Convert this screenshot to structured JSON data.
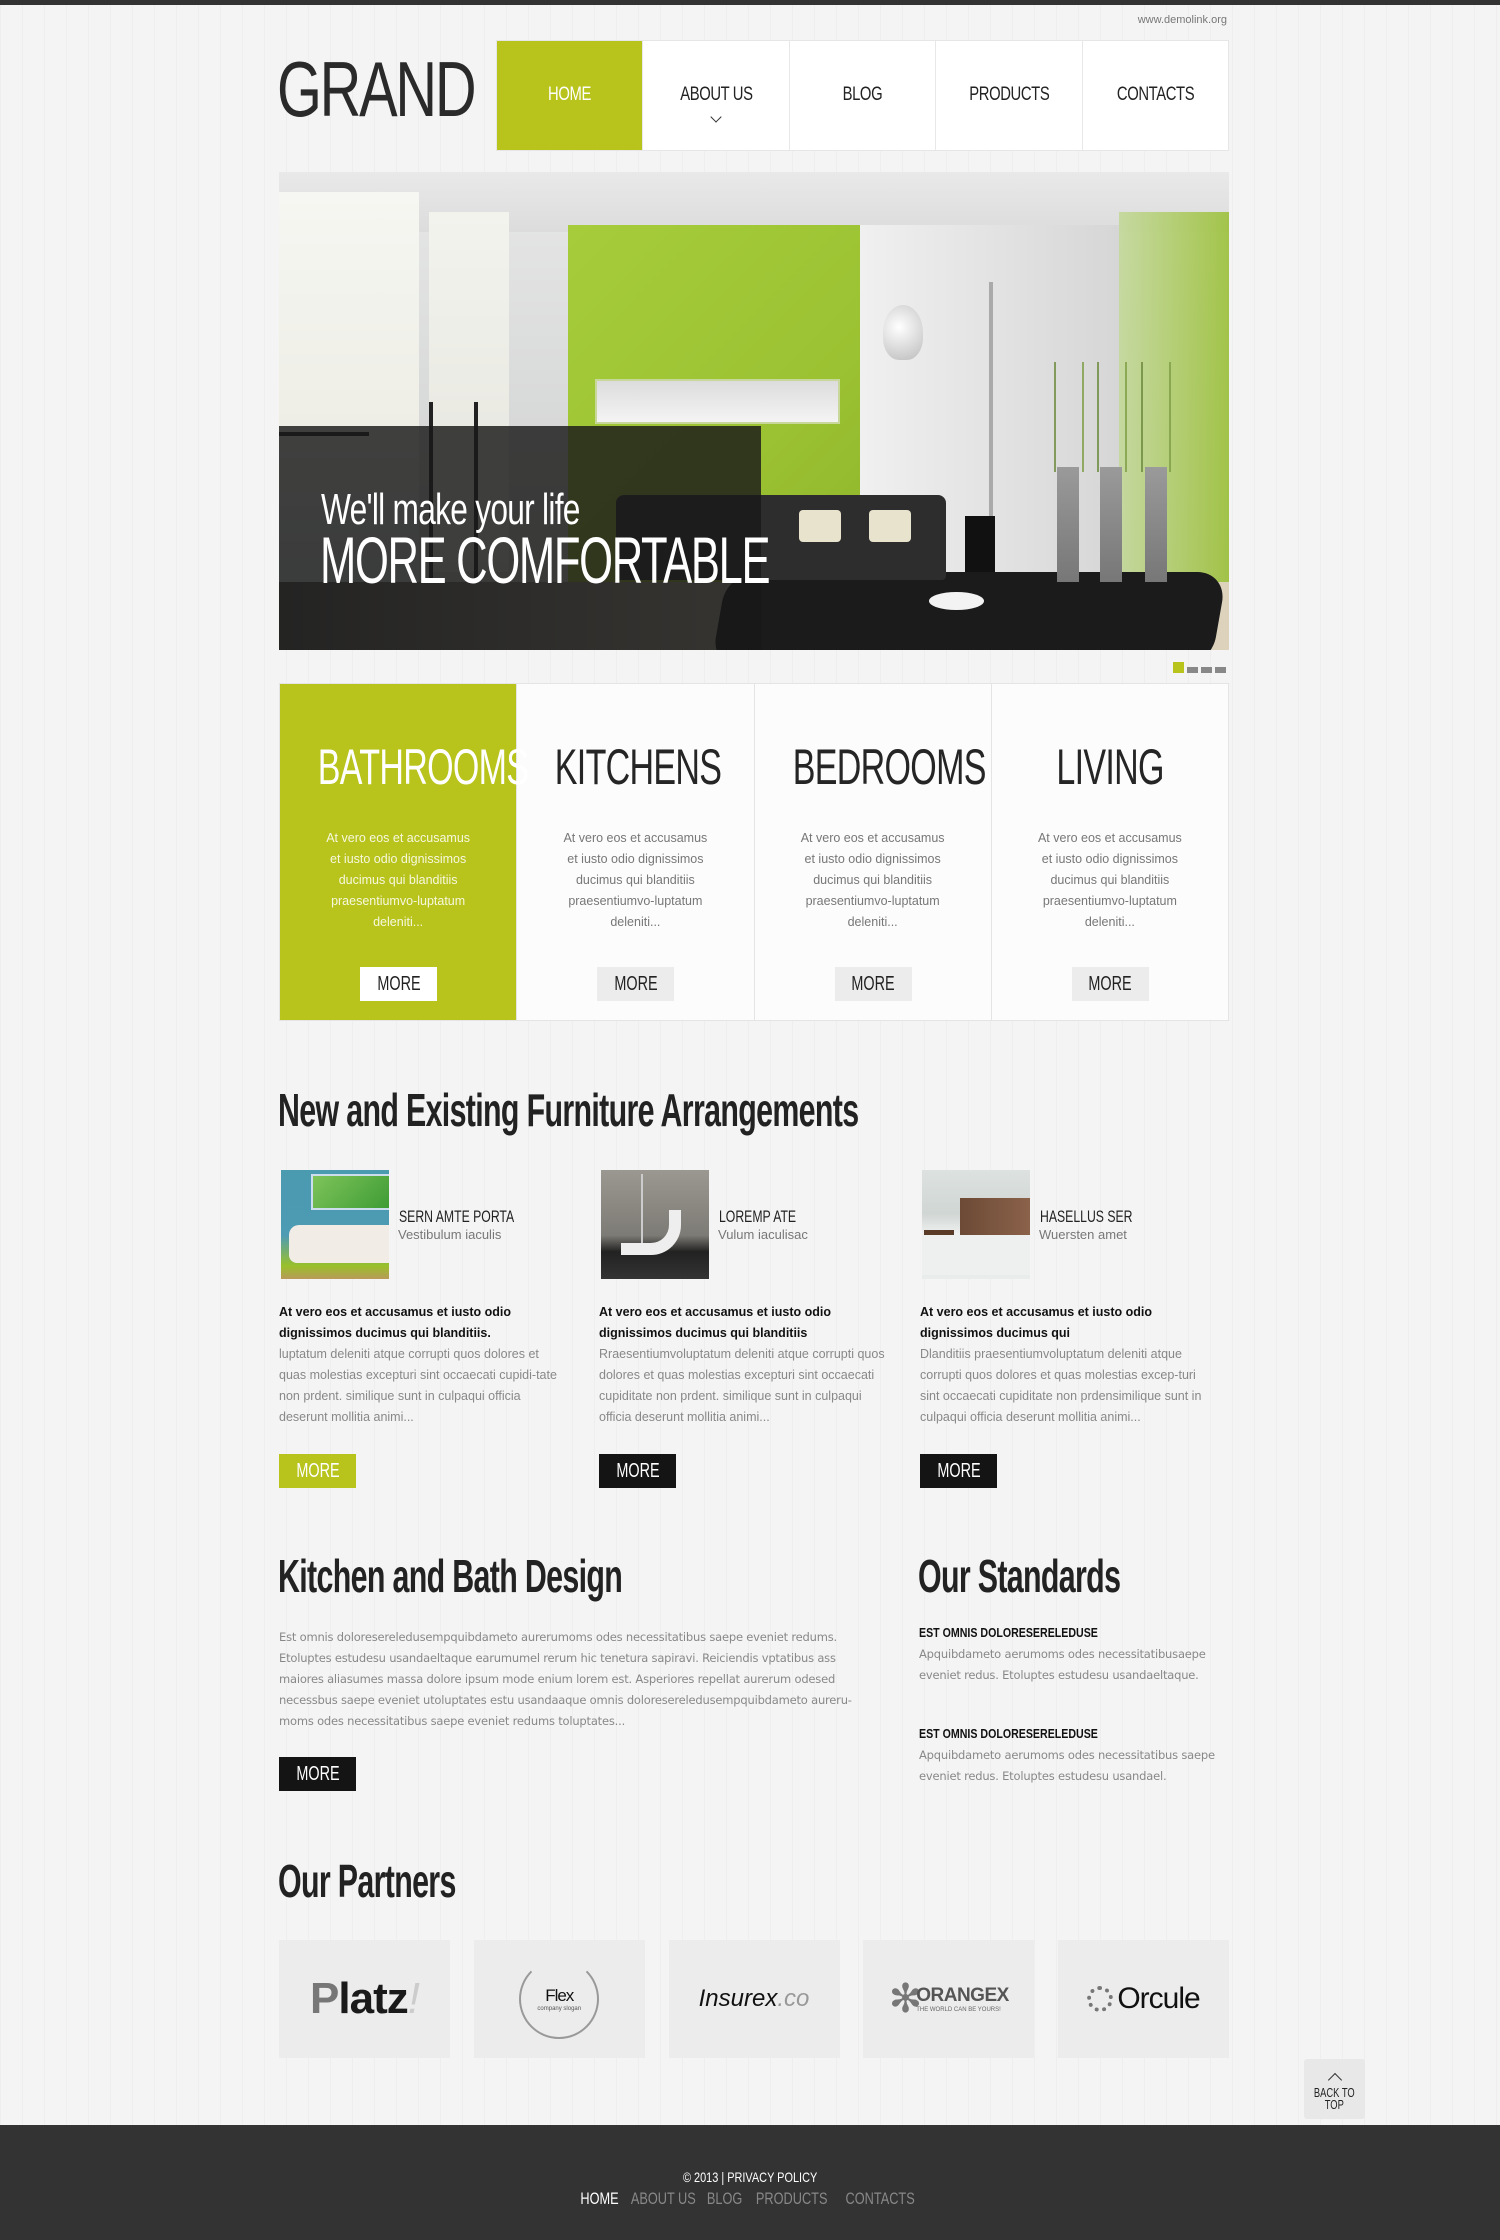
{
  "header": {
    "site_url": "www.demolink.org",
    "logo": "GRAND",
    "nav": [
      {
        "label": "HOME",
        "active": true
      },
      {
        "label": "ABOUT US",
        "has_dropdown": true
      },
      {
        "label": "BLOG"
      },
      {
        "label": "PRODUCTS"
      },
      {
        "label": "CONTACTS"
      }
    ]
  },
  "hero": {
    "line1": "We'll make your life",
    "line2": "MORE COMFORTABLE",
    "slides_total": 4,
    "active_slide": 1
  },
  "categories": [
    {
      "title": "BATHROOMS",
      "text": "At vero eos et accusamus et iusto odio dignissimos ducimus qui blanditiis praesentiumvo-luptatum deleniti...",
      "button": "MORE",
      "active": true
    },
    {
      "title": "KITCHENS",
      "text": "At vero eos et accusamus et iusto odio dignissimos ducimus qui blanditiis praesentiumvo-luptatum deleniti...",
      "button": "MORE"
    },
    {
      "title": "BEDROOMS",
      "text": "At vero eos et accusamus et iusto odio dignissimos ducimus qui blanditiis praesentiumvo-luptatum deleniti...",
      "button": "MORE"
    },
    {
      "title": "LIVING",
      "text": "At vero eos et accusamus et iusto odio dignissimos ducimus qui blanditiis praesentiumvo-luptatum deleniti...",
      "button": "MORE"
    }
  ],
  "furniture": {
    "title": "New and Existing Furniture Arrangements",
    "items": [
      {
        "name": "SERN AMTE PORTA",
        "sub": "Vestibulum iaculis",
        "lead": "At vero eos et accusamus et iusto odio dignissimos ducimus qui blanditiis.",
        "body": "luptatum deleniti atque corrupti quos dolores et quas molestias excepturi sint occaecati cupidi-tate non prdent. similique sunt in culpaqui officia deserunt mollitia animi...",
        "button": "MORE"
      },
      {
        "name": "LOREMP ATE",
        "sub": "Vulum iaculisac",
        "lead": "At vero eos et accusamus et iusto odio dignissimos ducimus qui blanditiis",
        "body": "Rraesentiumvoluptatum deleniti atque corrupti quos dolores et quas molestias excepturi sint occaecati cupiditate non prdent. similique sunt in culpaqui officia deserunt mollitia animi...",
        "button": "MORE"
      },
      {
        "name": "HASELLUS SER",
        "sub": "Wuersten amet",
        "lead": "At vero eos et accusamus et iusto odio dignissimos ducimus qui",
        "body": "Dlanditiis praesentiumvoluptatum deleniti atque corrupti quos dolores et quas molestias excep-turi sint occaecati cupiditate non prdensimilique sunt in culpaqui officia deserunt mollitia animi...",
        "button": "MORE"
      }
    ]
  },
  "kitchen_bath": {
    "title": "Kitchen and Bath Design",
    "text": "Est omnis doloresereledusempquibdameto aurerumoms odes necessitatibus saepe eveniet redums. Etoluptes estudesu usandaeltaque earumumel rerum hic tenetura sapiravi. Reiciendis vptatibus ass maiores aliasumes massa dolore ipsum mode enium lorem est. Asperiores repellat aurerum odesed necessbus saepe eveniet utoluptates estu usandaaque omnis doloresereledusempquibdameto aureru-moms odes necessitatibus saepe eveniet redums toluptates...",
    "button": "MORE"
  },
  "standards": {
    "title": "Our Standards",
    "items": [
      {
        "title": "EST OMNIS DOLORESERELEDUSE",
        "text": "Apquibdameto aerumoms odes necessitatibusaepe eveniet redus. Etoluptes estudesu usandaeltaque."
      },
      {
        "title": "EST OMNIS DOLORESERELEDUSE",
        "text": "Apquibdameto aerumoms odes necessitatibus saepe eveniet redus. Etoluptes estudesu usandael."
      }
    ]
  },
  "partners": {
    "title": "Our Partners",
    "logos": [
      {
        "name": "Platz!",
        "icon": "platz-logo"
      },
      {
        "name": "Flex",
        "slogan": "company slogan",
        "icon": "flex-logo"
      },
      {
        "name": "Insurex",
        "suffix": ".co",
        "icon": "insurex-logo"
      },
      {
        "name": "ORANGEX",
        "slogan": "THE WORLD CAN BE YOURS!",
        "icon": "orangex-logo"
      },
      {
        "name": "Orcule",
        "icon": "orcule-logo"
      }
    ]
  },
  "back_to_top": {
    "label_line1": "BACK TO",
    "label_line2": "TOP",
    "icon": "chevron-up-icon"
  },
  "footer": {
    "copyright": "© 2013 | PRIVACY POLICY",
    "nav": [
      {
        "label": "HOME",
        "active": true
      },
      {
        "label": "ABOUT US"
      },
      {
        "label": "BLOG"
      },
      {
        "label": "PRODUCTS"
      },
      {
        "label": "CONTACTS"
      }
    ]
  },
  "colors": {
    "accent": "#b8c31b",
    "dark": "#333333",
    "button_dark": "#141414",
    "button_light": "#ececec"
  }
}
